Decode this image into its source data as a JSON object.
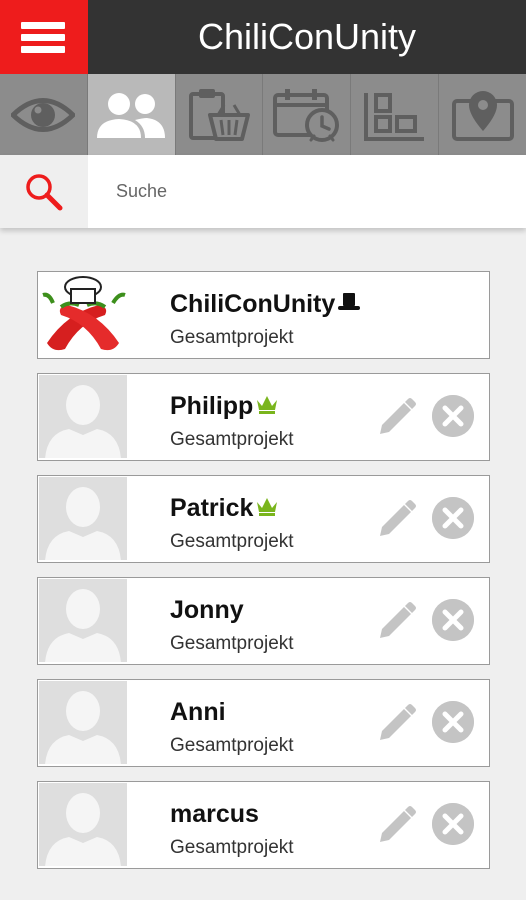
{
  "header": {
    "title": "ChiliConUnity",
    "menu_icon": "hamburger-menu-icon"
  },
  "tabs": [
    {
      "icon": "eye-icon",
      "active": false
    },
    {
      "icon": "people-icon",
      "active": true
    },
    {
      "icon": "clipboard-basket-icon",
      "active": false
    },
    {
      "icon": "calendar-clock-icon",
      "active": false
    },
    {
      "icon": "layout-icon",
      "active": false
    },
    {
      "icon": "map-pin-icon",
      "active": false
    }
  ],
  "search": {
    "placeholder": "Suche",
    "value": ""
  },
  "members": [
    {
      "name": "ChiliConUnity",
      "project": "Gesamtprojekt",
      "badge": "top-hat",
      "avatar": "chili-logo",
      "editable": false
    },
    {
      "name": "Philipp",
      "project": "Gesamtprojekt",
      "badge": "crown",
      "avatar": "placeholder",
      "editable": true
    },
    {
      "name": "Patrick",
      "project": "Gesamtprojekt",
      "badge": "crown",
      "avatar": "placeholder",
      "editable": true
    },
    {
      "name": "Jonny",
      "project": "Gesamtprojekt",
      "badge": "",
      "avatar": "placeholder",
      "editable": true
    },
    {
      "name": "Anni",
      "project": "Gesamtprojekt",
      "badge": "",
      "avatar": "placeholder",
      "editable": true
    },
    {
      "name": "marcus",
      "project": "Gesamtprojekt",
      "badge": "",
      "avatar": "placeholder",
      "editable": true
    }
  ],
  "colors": {
    "brand_red": "#ee1c1c",
    "header_bg": "#333333",
    "tab_bg": "#8c8c8c",
    "tab_active_bg": "#b9b9b9",
    "crown_green": "#7ab51d",
    "action_gray": "#c4c4c4"
  }
}
